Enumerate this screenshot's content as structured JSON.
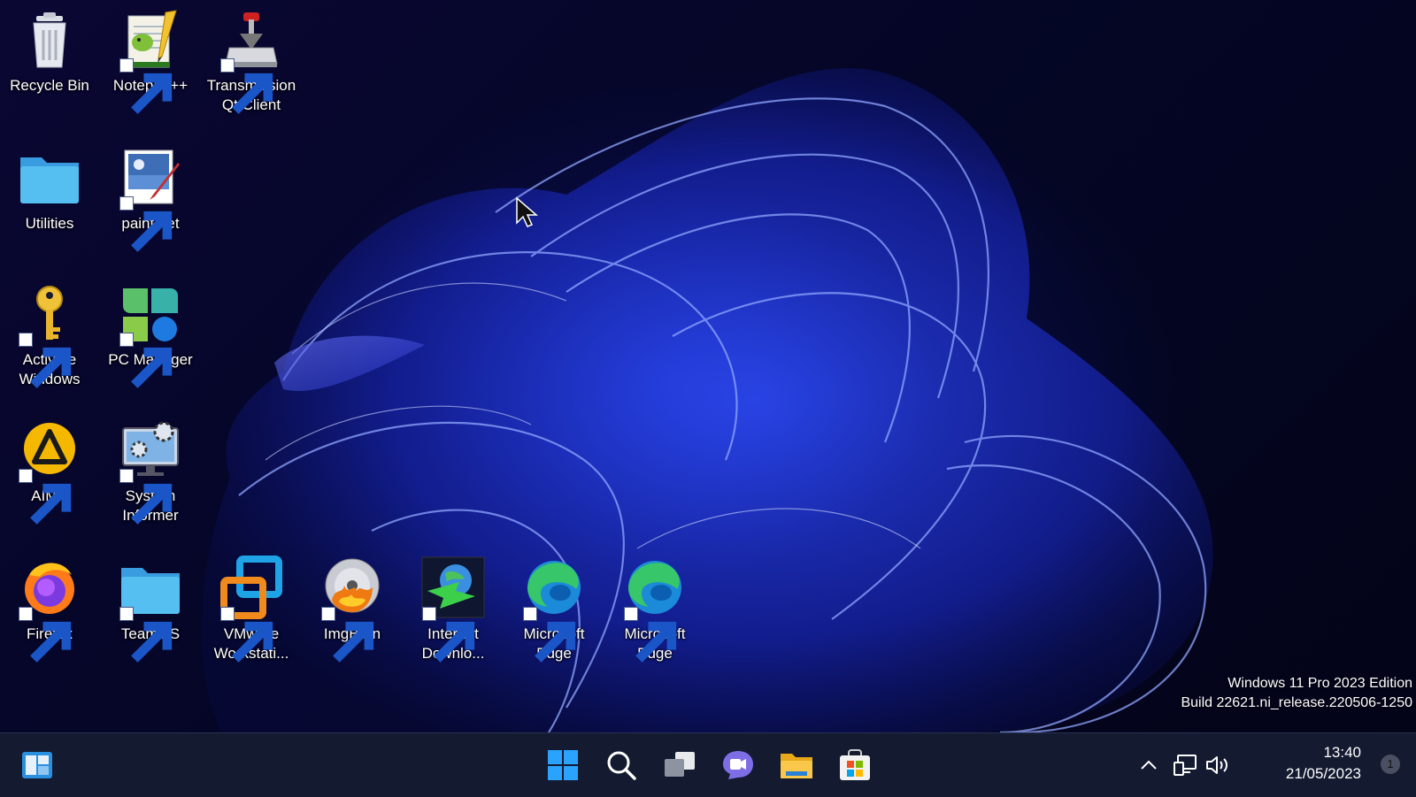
{
  "desktop_icons": [
    {
      "label": "Recycle Bin",
      "icon": "recycle-bin-icon"
    },
    {
      "label": "Notepad++",
      "icon": "notepad-plus-plus-icon"
    },
    {
      "label": "Transmission Qt Client",
      "icon": "transmission-icon"
    },
    {
      "label": "Utilities",
      "icon": "folder-icon"
    },
    {
      "label": "paint.net",
      "icon": "paint-net-icon"
    },
    {
      "label": "Activate Windows",
      "icon": "key-icon"
    },
    {
      "label": "PC Manager",
      "icon": "pc-manager-icon"
    },
    {
      "label": "AIMP",
      "icon": "aimp-icon"
    },
    {
      "label": "System Informer",
      "icon": "system-informer-icon"
    },
    {
      "label": "Firefox",
      "icon": "firefox-icon"
    },
    {
      "label": "TeamOS",
      "icon": "folder-icon"
    },
    {
      "label": "VMware Workstati...",
      "icon": "vmware-icon"
    },
    {
      "label": "ImgBurn",
      "icon": "imgburn-icon"
    },
    {
      "label": "Internet Downlo...",
      "icon": "internet-download-manager-icon"
    },
    {
      "label": "Microsoft Edge",
      "icon": "edge-icon"
    },
    {
      "label": "Microsoft Edge",
      "icon": "edge-icon"
    }
  ],
  "watermark": {
    "line1": "Windows 11 Pro 2023 Edition",
    "line2": "Build 22621.ni_release.220506-1250"
  },
  "taskbar": {
    "pinned": [
      "widgets-icon",
      "start-icon",
      "search-icon",
      "task-view-icon",
      "chat-icon",
      "file-explorer-icon",
      "microsoft-store-icon"
    ],
    "tray": {
      "icons": [
        "chevron-up-icon",
        "network-icon",
        "volume-icon"
      ],
      "time": "13:40",
      "date": "21/05/2023",
      "notification_count": "1"
    }
  },
  "colors": {
    "taskbar_bg": "#141a30",
    "folder": "#4fb6ef",
    "start_blue": "#2aa3ff",
    "wallpaper_accent": "#1e3cff"
  }
}
